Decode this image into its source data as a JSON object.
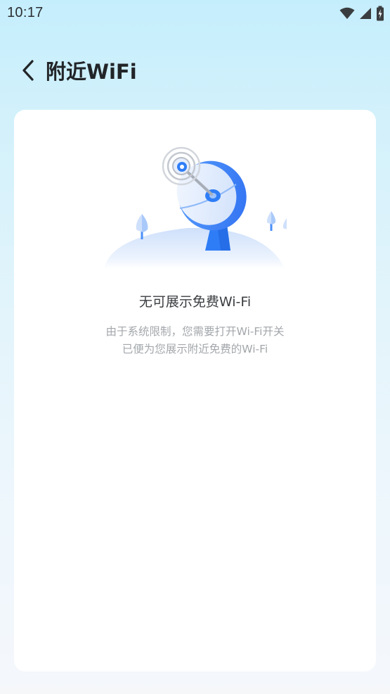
{
  "status_bar": {
    "time": "10:17",
    "icons": [
      "wifi-icon",
      "cellular-signal-icon",
      "battery-charging-icon"
    ]
  },
  "header": {
    "back_icon": "chevron-left-icon",
    "title": "附近WiFi"
  },
  "empty_state": {
    "illustration": "satellite-dish-illustration",
    "title": "无可展示免费Wi-Fi",
    "description_lines": [
      "由于系统限制，您需要打开Wi-Fi开关",
      "已便为您展示附近免费的Wi-Fi"
    ]
  },
  "colors": {
    "accent": "#2f7df6",
    "background_top": "#c5eefc",
    "card": "#ffffff",
    "title_text": "#222528",
    "secondary_text": "#a3a7ab"
  }
}
